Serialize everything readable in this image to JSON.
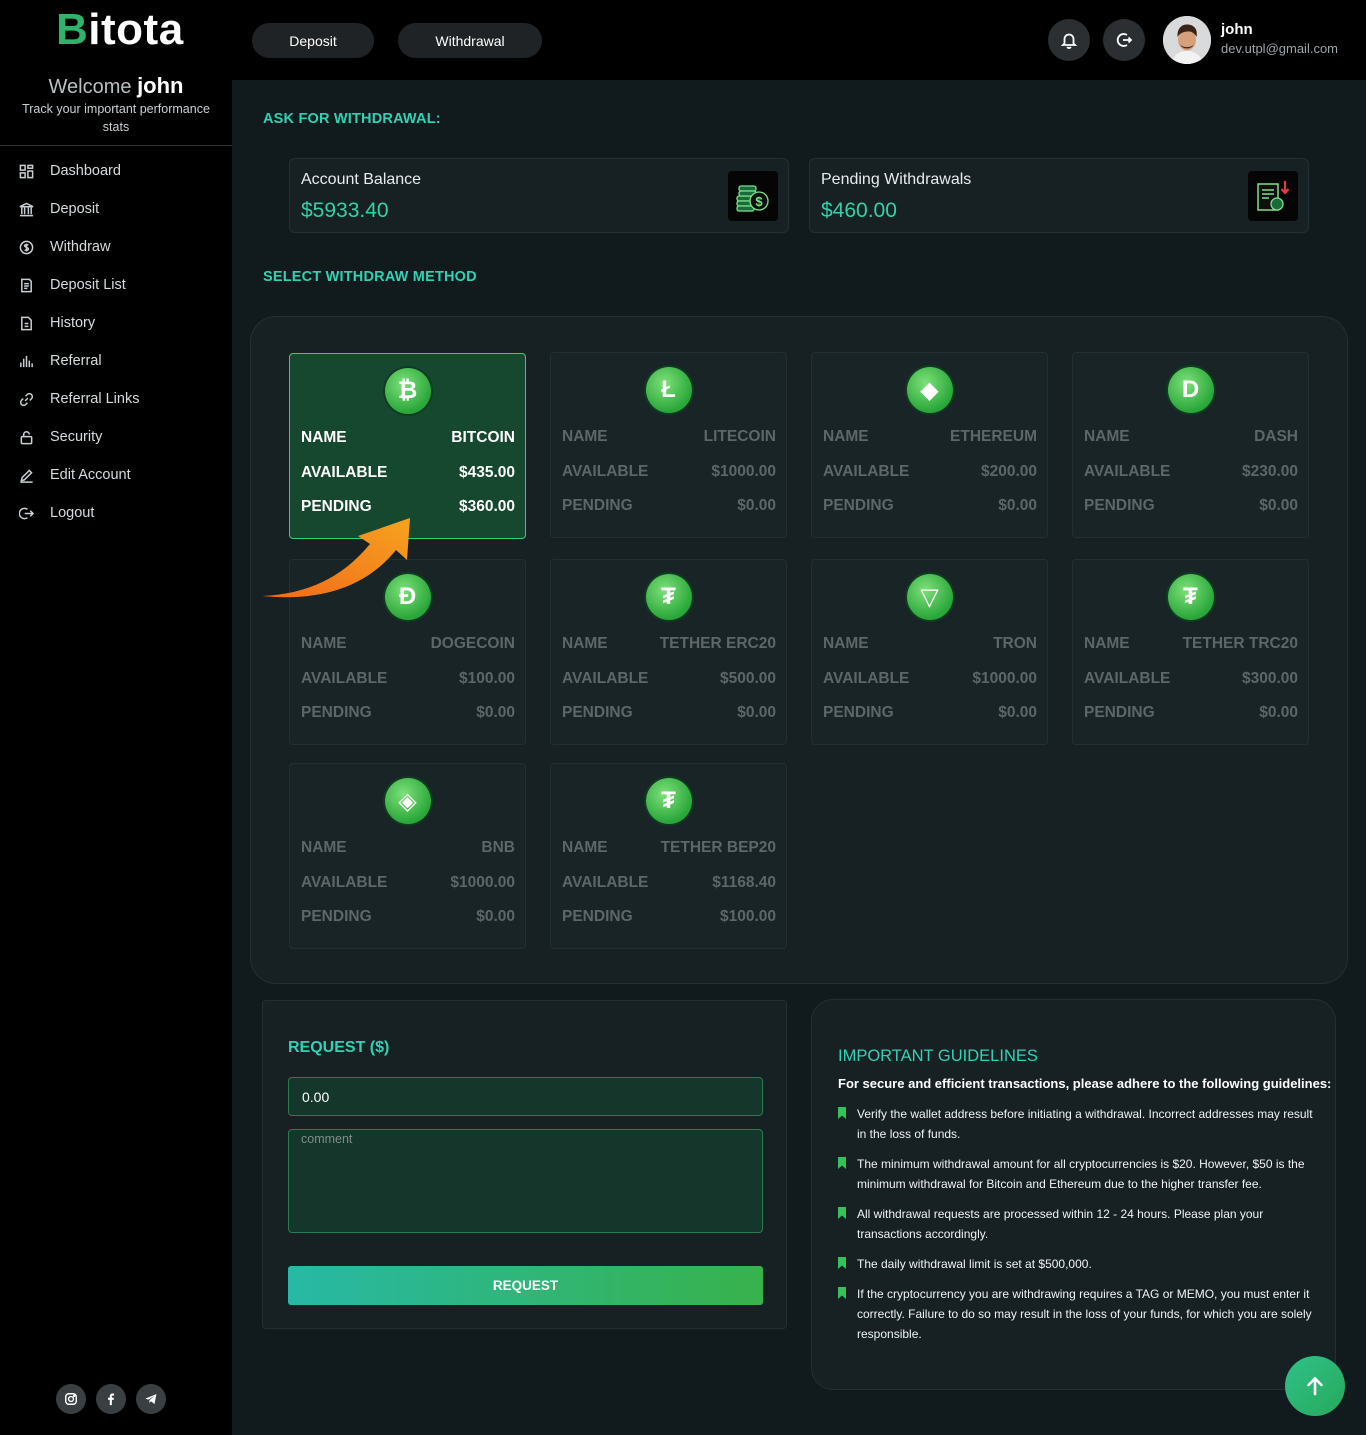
{
  "brand": {
    "logo_first": "B",
    "logo_rest": "itota"
  },
  "sidebar": {
    "welcome_prefix": "Welcome",
    "welcome_name": "john",
    "tagline": "Track your important performance stats",
    "items": [
      {
        "label": "Dashboard",
        "icon": "dashboard-icon"
      },
      {
        "label": "Deposit",
        "icon": "bank-icon"
      },
      {
        "label": "Withdraw",
        "icon": "dollar-circle-icon"
      },
      {
        "label": "Deposit List",
        "icon": "list-icon"
      },
      {
        "label": "History",
        "icon": "document-icon"
      },
      {
        "label": "Referral",
        "icon": "bar-chart-icon"
      },
      {
        "label": "Referral Links",
        "icon": "link-icon"
      },
      {
        "label": "Security",
        "icon": "lock-icon"
      },
      {
        "label": "Edit Account",
        "icon": "pencil-icon"
      },
      {
        "label": "Logout",
        "icon": "logout-icon"
      }
    ],
    "socials": [
      "instagram-icon",
      "facebook-icon",
      "telegram-icon"
    ]
  },
  "topbar": {
    "deposit_label": "Deposit",
    "withdrawal_label": "Withdrawal",
    "user_name": "john",
    "user_email": "dev.utpl@gmail.com"
  },
  "main": {
    "ask_title": "ASK FOR WITHDRAWAL:",
    "account_balance_label": "Account Balance",
    "account_balance_value": "$5933.40",
    "pending_withdrawals_label": "Pending Withdrawals",
    "pending_withdrawals_value": "$460.00",
    "select_title": "SELECT WITHDRAW METHOD"
  },
  "row_labels": {
    "name": "NAME",
    "available": "AVAILABLE",
    "pending": "PENDING"
  },
  "coins": [
    {
      "name": "BITCOIN",
      "available": "$435.00",
      "pending": "$360.00",
      "symbol": "₿",
      "selected": true
    },
    {
      "name": "LITECOIN",
      "available": "$1000.00",
      "pending": "$0.00",
      "symbol": "Ł",
      "selected": false
    },
    {
      "name": "ETHEREUM",
      "available": "$200.00",
      "pending": "$0.00",
      "symbol": "◆",
      "selected": false
    },
    {
      "name": "DASH",
      "available": "$230.00",
      "pending": "$0.00",
      "symbol": "D",
      "selected": false
    },
    {
      "name": "DOGECOIN",
      "available": "$100.00",
      "pending": "$0.00",
      "symbol": "Ð",
      "selected": false
    },
    {
      "name": "TETHER ERC20",
      "available": "$500.00",
      "pending": "$0.00",
      "symbol": "₮",
      "selected": false
    },
    {
      "name": "TRON",
      "available": "$1000.00",
      "pending": "$0.00",
      "symbol": "▽",
      "selected": false
    },
    {
      "name": "TETHER TRC20",
      "available": "$300.00",
      "pending": "$0.00",
      "symbol": "₮",
      "selected": false
    },
    {
      "name": "BNB",
      "available": "$1000.00",
      "pending": "$0.00",
      "symbol": "◈",
      "selected": false
    },
    {
      "name": "TETHER BEP20",
      "available": "$1168.40",
      "pending": "$100.00",
      "symbol": "₮",
      "selected": false
    }
  ],
  "request": {
    "title": "REQUEST ($)",
    "amount_value": "0.00",
    "comment_placeholder": "comment",
    "button_label": "REQUEST"
  },
  "guidelines": {
    "title": "IMPORTANT GUIDELINES",
    "subtitle": "For secure and efficient transactions, please adhere to the following guidelines:",
    "items": [
      "Verify the wallet address before initiating a withdrawal. Incorrect addresses may result in the loss of funds.",
      "The minimum withdrawal amount for all cryptocurrencies is $20. However, $50 is the minimum withdrawal for Bitcoin and Ethereum due to the higher transfer fee.",
      "All withdrawal requests are processed within 12 - 24 hours. Please plan your transactions accordingly.",
      "The daily withdrawal limit is set at $500,000.",
      "If the cryptocurrency you are withdrawing requires a TAG or MEMO, you must enter it correctly. Failure to do so may result in the loss of your funds, for which you are solely responsible."
    ]
  },
  "colors": {
    "accent": "#2fd3b4",
    "selected_card": "#16482f",
    "positive_value": "#2fd3a6"
  }
}
